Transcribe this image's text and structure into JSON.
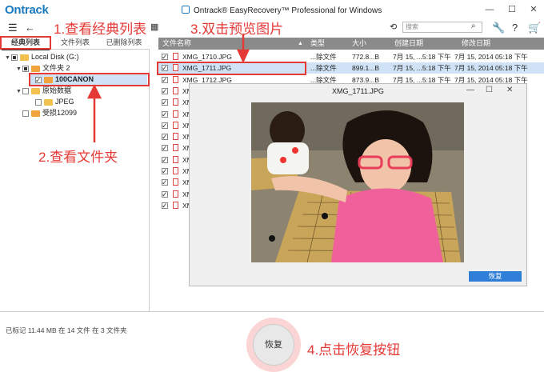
{
  "app": {
    "logo": "Ontrack",
    "title": "Ontrack® EasyRecovery™ Professional for Windows",
    "search_placeholder": "搜索"
  },
  "left_tabs": [
    "经典列表",
    "文件列表",
    "已删除列表"
  ],
  "tree": [
    {
      "label": "Local Disk (G:)",
      "check": "partial",
      "expander": "▼"
    },
    {
      "label": "文件夹 2",
      "check": "partial",
      "expander": "▼"
    },
    {
      "label": "100CANON",
      "check": "checked",
      "expander": ""
    },
    {
      "label": "原始数据",
      "check": "none",
      "expander": "▼"
    },
    {
      "label": "JPEG",
      "check": "none",
      "expander": ""
    },
    {
      "label": "受损12099",
      "check": "none",
      "expander": ""
    }
  ],
  "table": {
    "headers": [
      "文件名称",
      "类型",
      "大小",
      "创建日期",
      "修改日期"
    ],
    "rows": [
      {
        "name": "XMG_1710.JPG",
        "type": "...除文件",
        "size": "772.8...B",
        "created": "7月 15, ...5:18 下午",
        "modified": "7月 15, 2014 05:18 下午"
      },
      {
        "name": "XMG_1711.JPG",
        "type": "...除文件",
        "size": "899.1...B",
        "created": "7月 15, ...5:18 下午",
        "modified": "7月 15, 2014 05:18 下午"
      },
      {
        "name": "XMG_1712.JPG",
        "type": "...除文件",
        "size": "873.9...B",
        "created": "7月 15, ...5:18 下午",
        "modified": "7月 15, 2014 05:18 下午"
      },
      {
        "name": "XM",
        "type": "",
        "size": "",
        "created": "",
        "modified": "下午"
      },
      {
        "name": "XM",
        "type": "",
        "size": "",
        "created": "",
        "modified": "下午"
      },
      {
        "name": "XM",
        "type": "",
        "size": "",
        "created": "",
        "modified": "下午"
      },
      {
        "name": "XM",
        "type": "",
        "size": "",
        "created": "",
        "modified": "下午"
      },
      {
        "name": "XM",
        "type": "",
        "size": "",
        "created": "",
        "modified": "下午"
      },
      {
        "name": "XM",
        "type": "",
        "size": "",
        "created": "",
        "modified": "下午"
      },
      {
        "name": "XM",
        "type": "",
        "size": "",
        "created": "",
        "modified": "下午"
      },
      {
        "name": "XM",
        "type": "",
        "size": "",
        "created": "",
        "modified": "下午"
      },
      {
        "name": "XM",
        "type": "",
        "size": "",
        "created": "",
        "modified": "下午"
      },
      {
        "name": "XM",
        "type": "",
        "size": "",
        "created": "",
        "modified": "下午"
      },
      {
        "name": "XM",
        "type": "",
        "size": "",
        "created": "",
        "modified": "下午"
      }
    ]
  },
  "preview": {
    "title": "XMG_1711.JPG",
    "restore_label": "恢复"
  },
  "status": "已标记 11.44 MB 在 14 文件 在 3 文件夹",
  "restore_button": "恢复",
  "annotations": {
    "step1": "1.查看经典列表",
    "step2": "2.查看文件夹",
    "step3": "3.双击预览图片",
    "step4": "4.点击恢复按钮"
  },
  "colors": {
    "accent": "#e53935",
    "brand": "#1a7ac0",
    "header": "#8a8a8a",
    "button": "#2f7ed8"
  }
}
